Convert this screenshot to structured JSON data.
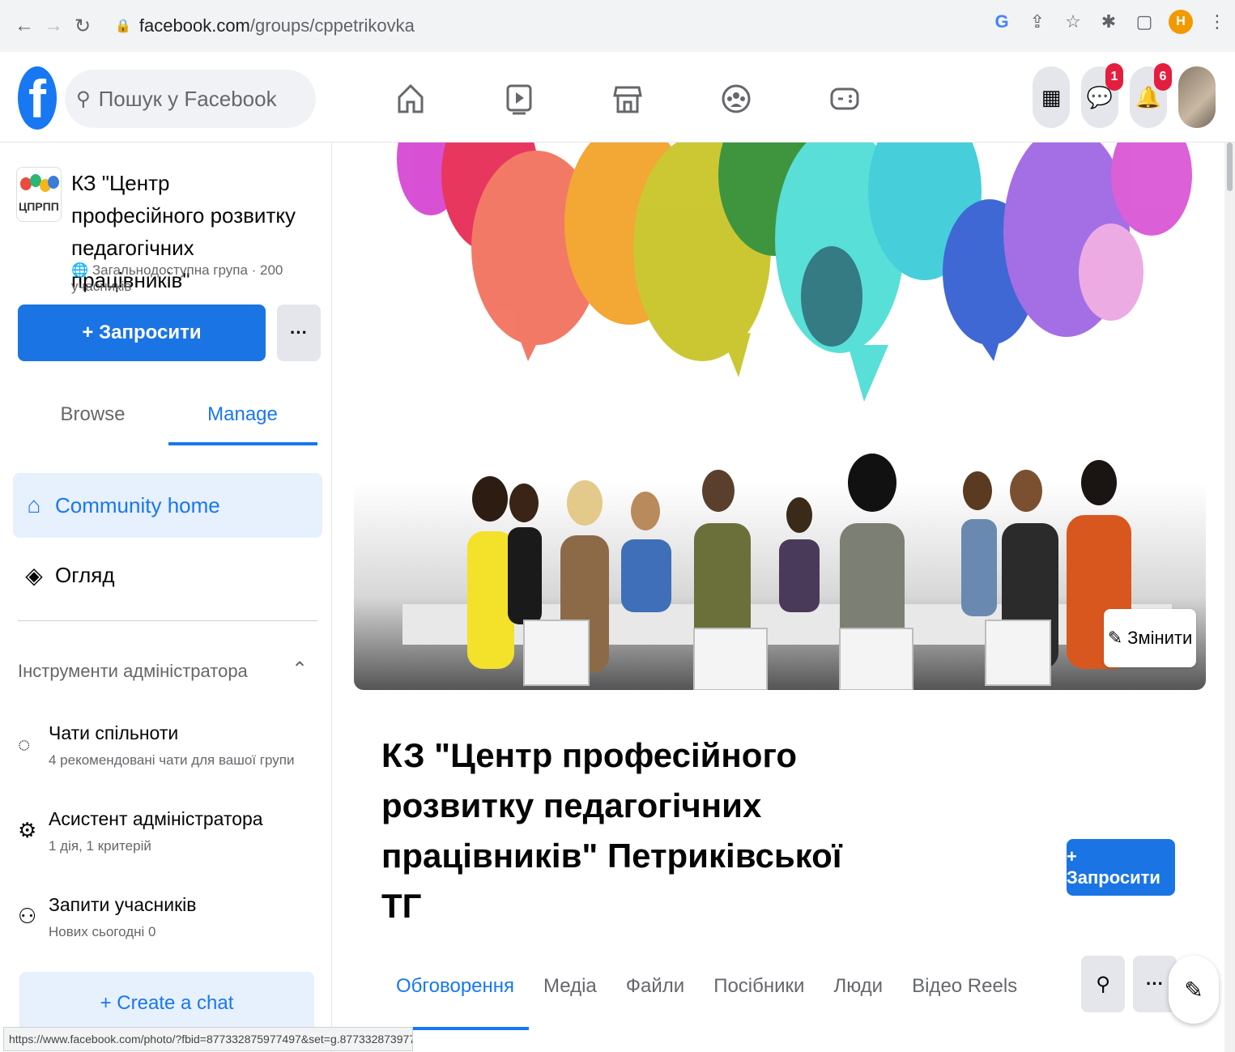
{
  "browser": {
    "url_host": "facebook.com",
    "url_path": "/groups/cppetrikovka",
    "profile_initial": "Н",
    "status_url": "https://www.facebook.com/photo/?fbid=877332875977497&set=g.877332873977..."
  },
  "topnav": {
    "search_placeholder": "Пошук у Facebook",
    "messenger_badge": "1",
    "notifications_badge": "6"
  },
  "sidebar": {
    "group_name": "КЗ \"Центр професійного розвитку педагогічних працівників\" Петриківської ТГ",
    "group_meta": "Загальнодоступна група · 200 учасників",
    "invite_label": "+ Запросити",
    "more_label": "···",
    "tab_browse": "Browse",
    "tab_manage": "Manage",
    "community_home": "Community home",
    "overview": "Огляд",
    "admin_tools_title": "Інструменти адміністратора",
    "tools": [
      {
        "title": "Чати спільноти",
        "subtitle": "4 рекомендовані чати для вашої групи"
      },
      {
        "title": "Асистент адміністратора",
        "subtitle": "1 дія, 1 критерій"
      },
      {
        "title": "Запити учасників",
        "subtitle": "Нових сьогодні 0"
      }
    ],
    "create_chat": "+ Create a chat"
  },
  "main": {
    "edit_cover": "Змінити",
    "title": "КЗ \"Центр професійного розвитку педагогічних працівників\" Петриківської ТГ",
    "invite_label": "+ Запросити",
    "tabs": [
      "Обговорення",
      "Медіа",
      "Файли",
      "Посібники",
      "Люди",
      "Відео Reels"
    ],
    "more_label": "···"
  },
  "colors": {
    "fb_blue": "#1877f2",
    "button_blue": "#1b74e4",
    "badge_red": "#e41e3f"
  }
}
